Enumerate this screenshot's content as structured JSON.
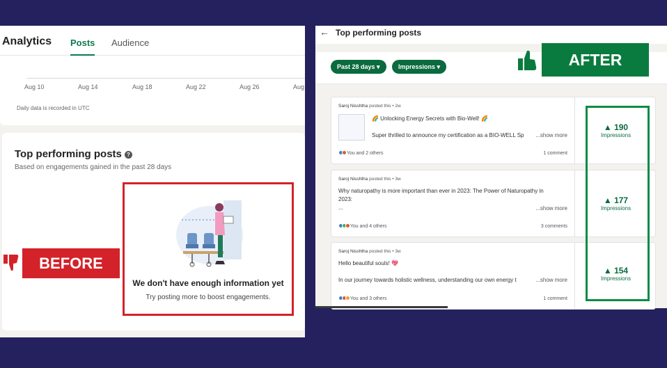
{
  "left": {
    "app_title": "Analytics",
    "tabs": [
      {
        "label": "Posts",
        "active": true
      },
      {
        "label": "Audience",
        "active": false
      }
    ],
    "chart": {
      "ticks": [
        "Aug 10",
        "Aug 14",
        "Aug 18",
        "Aug 22",
        "Aug 26",
        "Aug"
      ],
      "note": "Daily data is recorded in UTC"
    },
    "top_posts": {
      "title": "Top performing posts",
      "help_icon": "?",
      "subtitle": "Based on engagements gained in the past 28 days",
      "empty_title": "We don't have enough information yet",
      "empty_subtitle": "Try posting more to boost engagements."
    },
    "badge": "BEFORE"
  },
  "right": {
    "back_icon": "←",
    "title": "Top performing posts",
    "filters": [
      "Past 28 days ▾",
      "Impressions ▾"
    ],
    "badge": "AFTER",
    "posts": [
      {
        "author": "Saroj Nisshtha",
        "meta": "posted this • 2w",
        "line1": "🌈 Unlocking Energy Secrets with Bio-Well! 🌈",
        "line2": "Super thrilled to announce my certification as a BIO-WELL Sp",
        "line3": "",
        "more": "...show more",
        "reactions": "You and 2 others",
        "comments": "1 comment",
        "metric_value": "▲ 190",
        "metric_label": "Impressions"
      },
      {
        "author": "Saroj Nisshtha",
        "meta": "posted this • 3w",
        "line1": "Why naturopathy is more important than ever in 2023: The Power of Naturopathy in",
        "line2": "2023:",
        "line3": "...",
        "more": "...show more",
        "reactions": "You and 4 others",
        "comments": "3 comments",
        "metric_value": "▲ 177",
        "metric_label": "Impressions"
      },
      {
        "author": "Saroj Nisshtha",
        "meta": "posted this • 3w",
        "line1": "Hello beautiful souls! 💖",
        "line2": "",
        "line3": "In our journey towards holistic wellness, understanding our own energy t",
        "more": "...show more",
        "reactions": "You and 3 others",
        "comments": "1 comment",
        "metric_value": "▲ 154",
        "metric_label": "Impressions"
      }
    ]
  },
  "colors": {
    "background": "#24215e",
    "brand_green": "#0a7b3e",
    "before_red": "#d3222a",
    "linkedin_green": "#0a6b3f"
  }
}
